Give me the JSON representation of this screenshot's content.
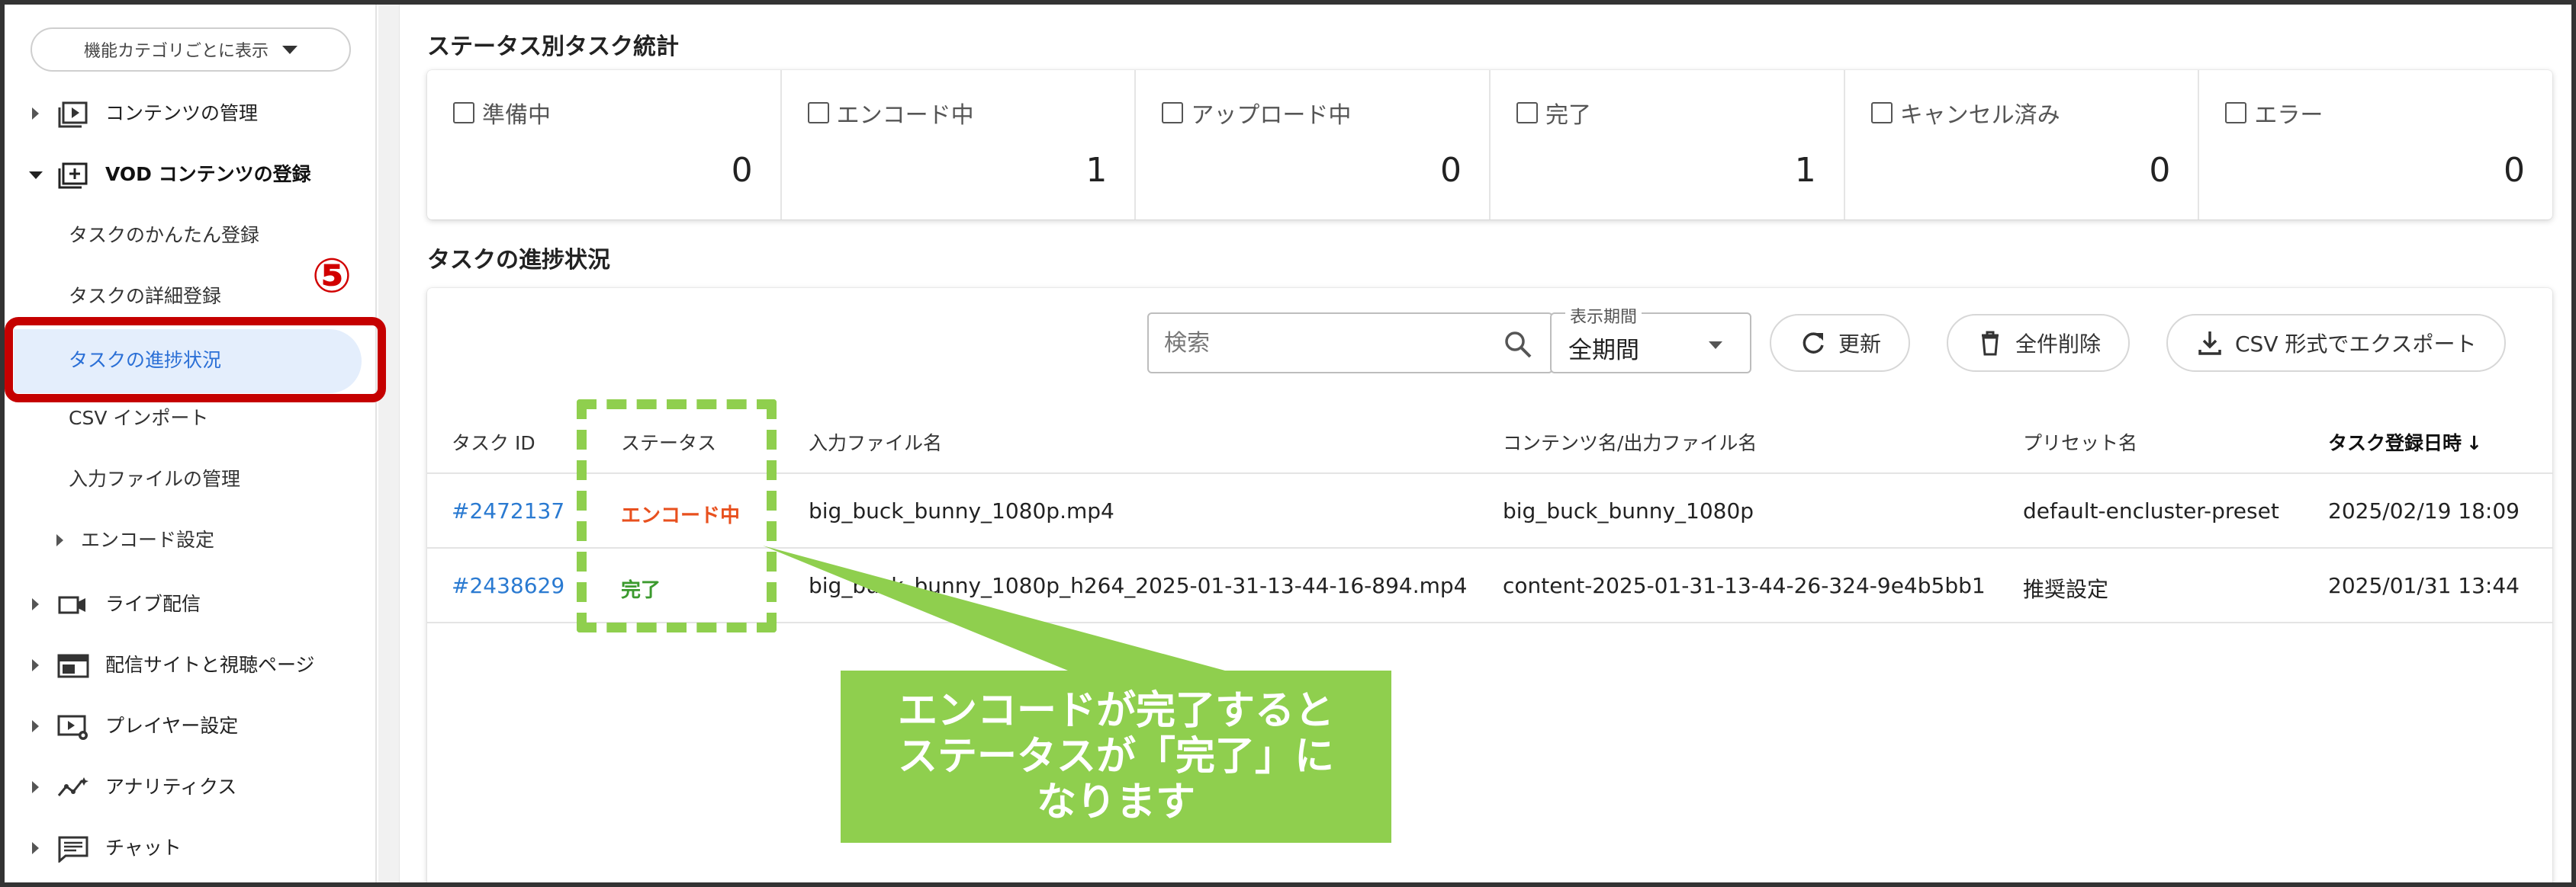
{
  "sidebar": {
    "category_select": "機能カテゴリごとに表示",
    "items": [
      {
        "label": "コンテンツの管理",
        "icon": "content-play-icon"
      },
      {
        "label": "VOD コンテンツの登録",
        "icon": "add-box-icon"
      },
      {
        "label": "ライブ配信",
        "icon": "videocam-icon"
      },
      {
        "label": "配信サイトと視聴ページ",
        "icon": "web-icon"
      },
      {
        "label": "プレイヤー設定",
        "icon": "player-settings-icon"
      },
      {
        "label": "アナリティクス",
        "icon": "analytics-icon"
      },
      {
        "label": "チャット",
        "icon": "chat-icon"
      }
    ],
    "sub_items": {
      "quick": "タスクのかんたん登録",
      "detail": "タスクの詳細登録",
      "progress": "タスクの進捗状況",
      "csv_import": "CSV インポート",
      "input_files": "入力ファイルの管理",
      "encode_settings": "エンコード設定"
    },
    "step_number": "⑤"
  },
  "stats": {
    "title": "ステータス別タスク統計",
    "cards": [
      {
        "name": "準備中",
        "value": "0"
      },
      {
        "name": "エンコード中",
        "value": "1"
      },
      {
        "name": "アップロード中",
        "value": "0"
      },
      {
        "name": "完了",
        "value": "1"
      },
      {
        "name": "キャンセル済み",
        "value": "0"
      },
      {
        "name": "エラー",
        "value": "0"
      }
    ]
  },
  "progress": {
    "title": "タスクの進捗状況",
    "search_placeholder": "検索",
    "period_label": "表示期間",
    "period_value": "全期間",
    "refresh_label": "更新",
    "delete_all_label": "全件削除",
    "export_label": "CSV 形式でエクスポート",
    "columns": [
      "タスク ID",
      "ステータス",
      "入力ファイル名",
      "コンテンツ名/出力ファイル名",
      "プリセット名",
      "タスク登録日時"
    ],
    "sort_indicator": "↓",
    "rows": [
      {
        "id": "#2472137",
        "status": "エンコード中",
        "input": "big_buck_bunny_1080p.mp4",
        "output": "big_buck_bunny_1080p",
        "preset": "default-encluster-preset",
        "date": "2025/02/19 18:09"
      },
      {
        "id": "#2438629",
        "status": "完了",
        "input": "big_buck_bunny_1080p_h264_2025-01-31-13-44-16-894.mp4",
        "output": "content-2025-01-31-13-44-26-324-9e4b5bb1",
        "preset": "推奨設定",
        "date": "2025/01/31 13:44"
      }
    ]
  },
  "annotation": {
    "lines": [
      "エンコードが完了すると",
      "ステータスが「完了」に",
      "なります"
    ],
    "color": "#8fcf4e"
  },
  "colors": {
    "accent": "#2a6fd6",
    "link": "#2a7ad1",
    "encoding": "#e8501e",
    "done": "#3b9a2e",
    "highlight_red": "#c50000"
  }
}
